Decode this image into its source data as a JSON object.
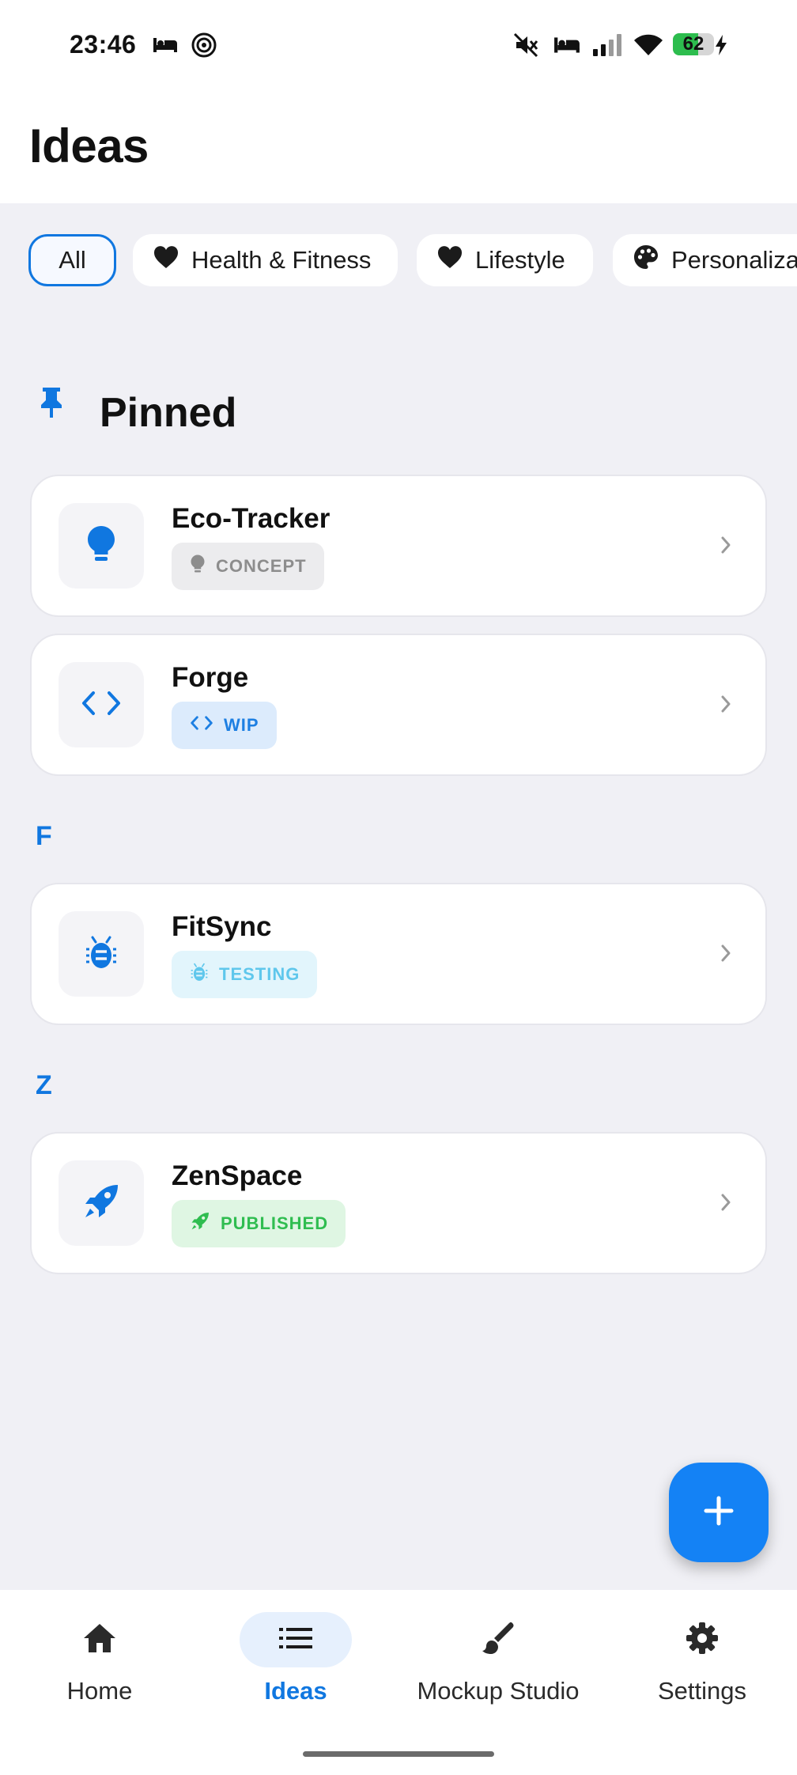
{
  "status_bar": {
    "time": "23:46",
    "battery_level": "62",
    "battery_fraction": 0.62,
    "left_icons": [
      "bed-icon",
      "radar-icon"
    ],
    "right_icons": [
      "mute-icon",
      "bed-icon",
      "signal-icon",
      "wifi-icon",
      "charging-icon"
    ]
  },
  "header": {
    "title": "Ideas"
  },
  "filters": [
    {
      "label": "All",
      "icon": "",
      "active": true
    },
    {
      "label": "Health & Fitness",
      "icon": "heart-icon",
      "active": false
    },
    {
      "label": "Lifestyle",
      "icon": "heart-icon",
      "active": false
    },
    {
      "label": "Personaliza",
      "icon": "palette-icon",
      "active": false
    }
  ],
  "sections": {
    "pinned_label": "Pinned",
    "letter_f": "F",
    "letter_z": "Z"
  },
  "ideas": [
    {
      "name": "Eco-Tracker",
      "status": "CONCEPT",
      "icon": "lightbulb-icon",
      "status_color": "#8d8d8d",
      "badge_bg": "#ececee",
      "icon_color": "#1077e0"
    },
    {
      "name": "Forge",
      "status": "WIP",
      "icon": "code-icon",
      "status_color": "#1d7fe2",
      "badge_bg": "#dcebfc",
      "icon_color": "#1077e0"
    },
    {
      "name": "FitSync",
      "status": "TESTING",
      "icon": "bug-icon",
      "status_color": "#5fc7ec",
      "badge_bg": "#e2f5fc",
      "icon_color": "#1077e0"
    },
    {
      "name": "ZenSpace",
      "status": "PUBLISHED",
      "icon": "rocket-icon",
      "status_color": "#2fbd50",
      "badge_bg": "#dff6e3",
      "icon_color": "#1077e0"
    }
  ],
  "fab": {
    "icon": "plus-icon"
  },
  "nav": [
    {
      "label": "Home",
      "icon": "home-icon",
      "active": false
    },
    {
      "label": "Ideas",
      "icon": "list-icon",
      "active": true
    },
    {
      "label": "Mockup Studio",
      "icon": "brush-icon",
      "active": false
    },
    {
      "label": "Settings",
      "icon": "gear-icon",
      "active": false
    }
  ],
  "colors": {
    "accent": "#1077e0",
    "fab": "#1482f5",
    "background": "#f0f0f5"
  }
}
